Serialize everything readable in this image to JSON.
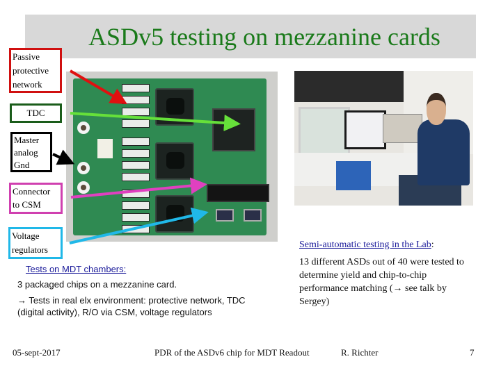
{
  "slide": {
    "title": "ASDv5 testing on mezzanine cards",
    "title_color": "#1a7a1a"
  },
  "callouts": {
    "passive": {
      "text": "Passive protective network",
      "color": "#d01010"
    },
    "tdc": {
      "text": "TDC",
      "color": "#1a5c1a"
    },
    "gnd": {
      "text": "Master analog Gnd",
      "color": "#000000"
    },
    "csm": {
      "text": "Connector to CSM",
      "color": "#d040b0"
    },
    "volt": {
      "text": "Voltage regulators",
      "color": "#20b8e8"
    }
  },
  "arrow_colors": {
    "passive": "#e01010",
    "tdc": "#66e03a",
    "gnd": "#000000",
    "csm": "#e040c0",
    "volt": "#20b8e8"
  },
  "images": {
    "board": "mezzanine-card-photo",
    "lab": "lab-test-setup-photo"
  },
  "left_section": {
    "heading": "Tests on MDT chambers:",
    "line1": "3 packaged chips on a mezzanine card.",
    "line2": "→ Tests in real elx environment: protective network, TDC (digital activity), R/O via CSM, voltage regulators"
  },
  "right_section": {
    "heading": "Semi-automatic testing in the Lab",
    "heading_suffix": ":",
    "body": "13 different ASDs out of 40  were tested to determine yield and chip-to-chip  performance matching  (→ see talk by Sergey)"
  },
  "footer": {
    "date": "05-sept-2017",
    "center": "PDR of the ASDv6 chip for MDT Readout",
    "author": "R. Richter",
    "page": "7"
  }
}
